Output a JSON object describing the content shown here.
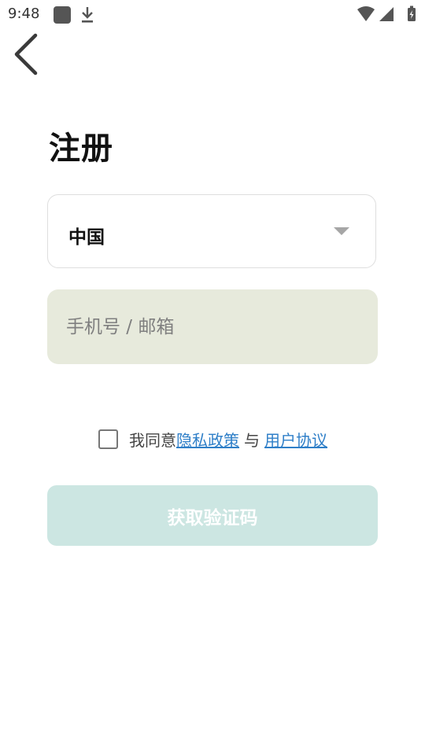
{
  "status_bar": {
    "time": "9:48",
    "icons": [
      "app-square-icon",
      "download-icon",
      "wifi-icon",
      "signal-icon",
      "battery-charging-icon"
    ]
  },
  "header": {
    "back_icon": "chevron-left-icon"
  },
  "page": {
    "title": "注册"
  },
  "country_select": {
    "value": "中国"
  },
  "account_input": {
    "placeholder": "手机号 / 邮箱",
    "value": ""
  },
  "agreement": {
    "checked": false,
    "prefix": "我同意",
    "privacy_link": "隐私政策",
    "separator": "与",
    "terms_link": "用户协议"
  },
  "submit_button": {
    "label": "获取验证码",
    "enabled": false
  },
  "colors": {
    "input_background": "#e7eadc",
    "button_disabled_background": "#cce6e2",
    "link": "#2f7fc8"
  }
}
